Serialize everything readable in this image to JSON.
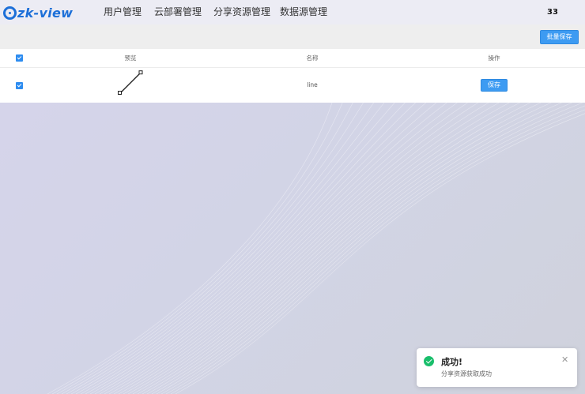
{
  "app": {
    "logo_text": "zk-view",
    "user_label": "33"
  },
  "nav": [
    {
      "label": "用户管理"
    },
    {
      "label": "云部署管理"
    },
    {
      "label": "分享资源管理"
    },
    {
      "label": "数据源管理"
    }
  ],
  "toolbar": {
    "batch_save_label": "批量保存"
  },
  "table": {
    "columns": [
      "预览",
      "名称",
      "操作"
    ],
    "header_checked": true,
    "rows": [
      {
        "checked": true,
        "preview_icon": "line-icon",
        "name": "line",
        "action_label": "保存"
      }
    ]
  },
  "toast": {
    "title": "成功!",
    "message": "分享资源获取成功",
    "status_color": "#19be6b",
    "icon": "check-circle-icon"
  },
  "colors": {
    "accent": "#3d9bf2",
    "brand": "#1c6fd8",
    "success": "#19be6b"
  }
}
